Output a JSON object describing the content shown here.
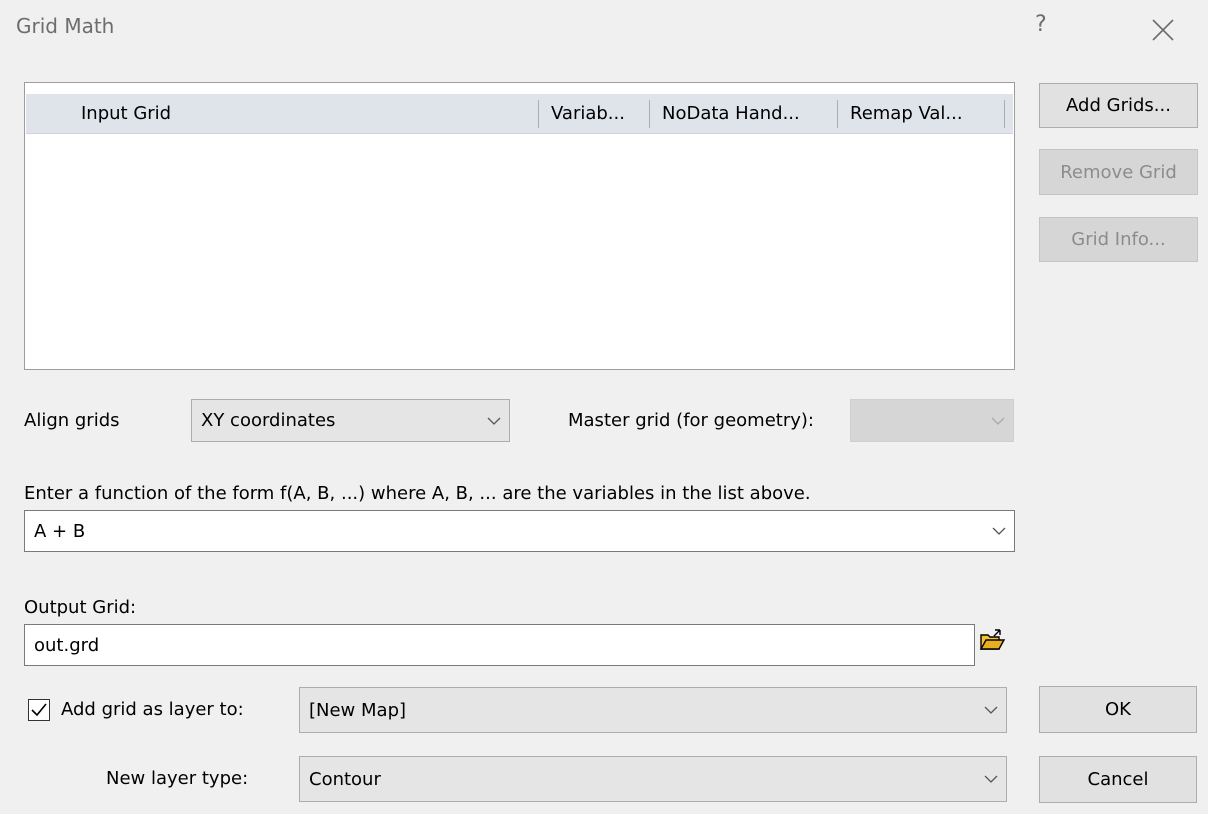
{
  "window": {
    "title": "Grid Math",
    "help_glyph": "?"
  },
  "grid_table": {
    "columns": [
      "Input Grid",
      "Variab...",
      "NoData Hand...",
      "Remap Val..."
    ],
    "rows": []
  },
  "side_buttons": {
    "add_grids": "Add Grids...",
    "remove_grid": "Remove Grid",
    "grid_info": "Grid Info..."
  },
  "align": {
    "label": "Align grids",
    "value": "XY coordinates",
    "master_label": "Master grid (for geometry):",
    "master_value": ""
  },
  "function": {
    "label": "Enter a function of the form f(A, B, ...) where A, B, ... are the variables in the list above.",
    "value": "A + B"
  },
  "output": {
    "label": "Output Grid:",
    "value": "out.grd"
  },
  "add_layer": {
    "checked": true,
    "label": "Add grid as layer to:",
    "value": "[New Map]"
  },
  "layer_type": {
    "label": "New layer type:",
    "value": "Contour"
  },
  "actions": {
    "ok": "OK",
    "cancel": "Cancel"
  },
  "icons": {
    "close": "close-icon",
    "folder": "folder-open-icon",
    "chevron": "chevron-down-icon",
    "check": "checkmark-icon"
  }
}
